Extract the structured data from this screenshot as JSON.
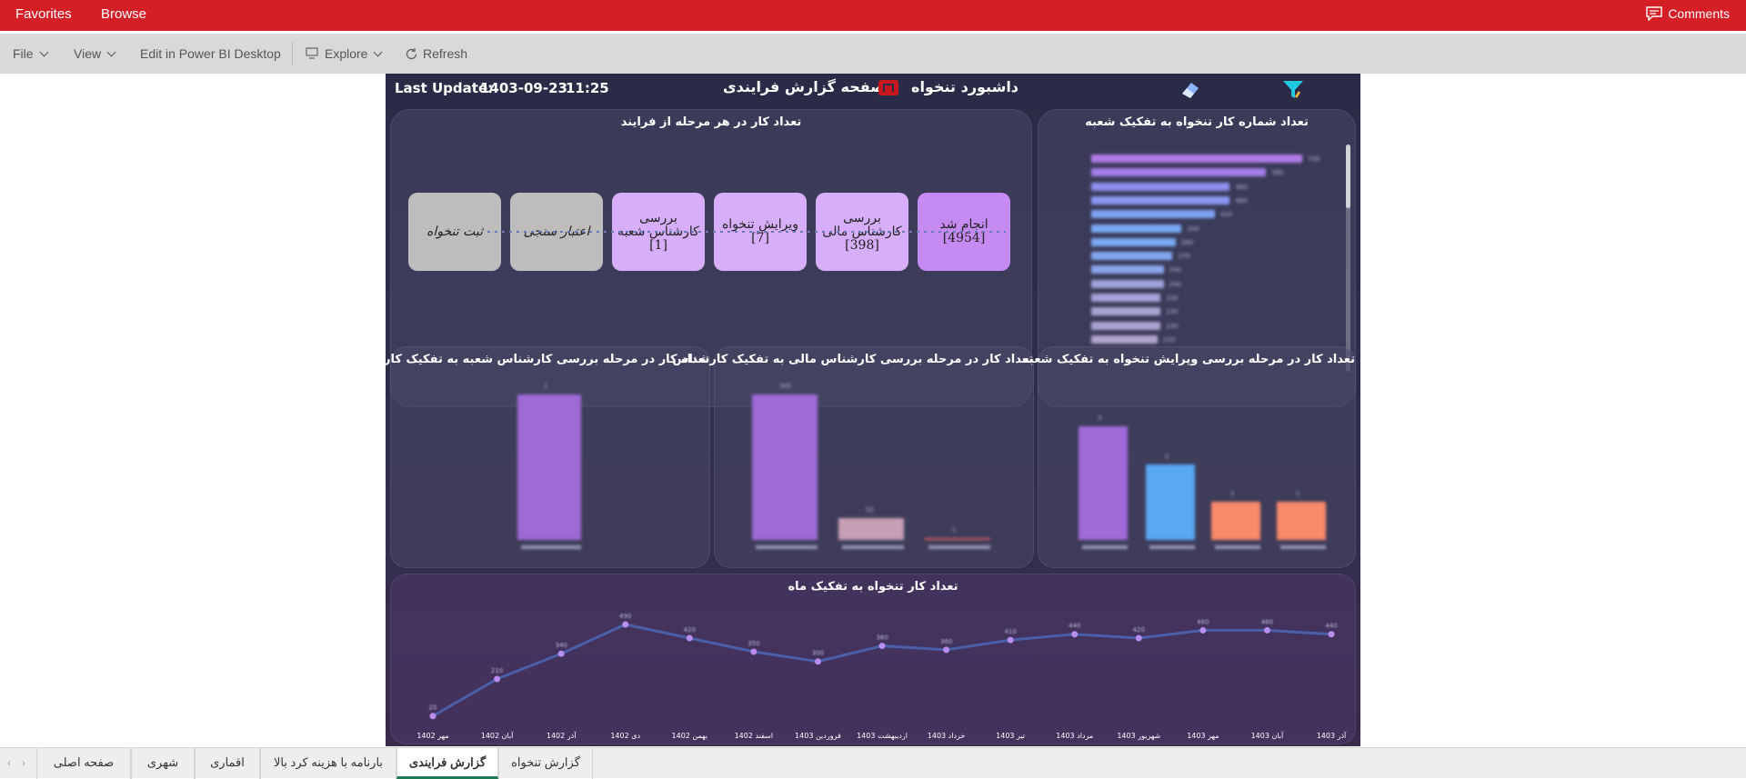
{
  "topbar": {
    "favorites": "Favorites",
    "browse": "Browse",
    "comments": "Comments"
  },
  "toolbar": {
    "file": "File",
    "view": "View",
    "edit": "Edit in Power BI Desktop",
    "explore": "Explore",
    "refresh": "Refresh"
  },
  "header": {
    "last_update_label": "Last Update:",
    "last_update_date": "1403-09-23",
    "last_update_time": "11:25",
    "title_right": "داشبورد  تنخواه",
    "title_left": "صفحه گزارش فرایندی"
  },
  "panels": {
    "process": {
      "title": "تعداد کار در هر مرحله از فرایند",
      "steps": [
        {
          "label": "انجام شد",
          "count": "[4954]",
          "state": "done"
        },
        {
          "label": "بررسی کارشناس مالی",
          "count": "[398]",
          "state": "active"
        },
        {
          "label": "ویرایش تنخواه",
          "count": "[7]",
          "state": "active"
        },
        {
          "label": "بررسی کارشناس شعبه",
          "count": "[1]",
          "state": "active"
        },
        {
          "label": "اعتبار سنجی",
          "count": "",
          "state": "idle"
        },
        {
          "label": "ثبت تنخواه",
          "count": "",
          "state": "idle"
        }
      ]
    },
    "branch": {
      "title": "تعداد شماره کار تنخواه به تفکیک شعبه"
    },
    "expert_branch": {
      "title": "تعداد کار در مرحله بررسی کارشناس شعبه به تفکیک کارشناس"
    },
    "expert_finance": {
      "title": "تعداد کار در مرحله بررسی کارشناس مالی به تفکیک کارشناس"
    },
    "edit_branch": {
      "title": "تعداد کار در مرحله بررسی وپرایش تنخواه به تفکیک شعبه"
    },
    "monthly": {
      "title": "تعداد کار تنخواه به تفکیک ماه"
    }
  },
  "chart_data": [
    {
      "type": "line",
      "title": "تعداد کار تنخواه به تفکیک ماه",
      "categories": [
        "مهر 1402",
        "آبان 1402",
        "آذر 1402",
        "دی 1402",
        "بهمن 1402",
        "اسفند 1402",
        "فروردین 1403",
        "اردیبهشت 1403",
        "خرداد 1403",
        "تیر 1403",
        "مرداد 1403",
        "شهریور 1403",
        "مهر 1403",
        "آبان 1403",
        "آذر 1403"
      ],
      "values": [
        20,
        210,
        340,
        490,
        420,
        350,
        300,
        380,
        360,
        410,
        440,
        420,
        460,
        460,
        440
      ],
      "ylim": [
        0,
        560
      ]
    },
    {
      "type": "bar",
      "title": "تعداد کار در مرحله بررسی کارشناس مالی به تفکیک کارشناس",
      "values": [
        345,
        52,
        1
      ]
    },
    {
      "type": "bar",
      "title": "تعداد کار در مرحله بررسی وپرایش تنخواه به تفکیک شعبه",
      "values": [
        3,
        2,
        1,
        1
      ]
    },
    {
      "type": "bar",
      "title": "تعداد کار در مرحله بررسی کارشناس شعبه به تفکیک کارشناس",
      "values": [
        1
      ]
    },
    {
      "type": "bar",
      "title": "تعداد شماره کار تنخواه به تفکیک شعبه",
      "values": [
        700,
        580,
        460,
        460,
        410,
        300,
        280,
        270,
        240,
        240,
        230,
        230,
        230,
        220
      ],
      "colors": [
        "#b07be6",
        "#a47de8",
        "#8f8ff0",
        "#8a97f2",
        "#7ea2f4",
        "#7aa8f4",
        "#7aa8f4",
        "#82a8f0",
        "#8aa5ec",
        "#a0a4dc",
        "#a4a4d8",
        "#a8a4d4",
        "#aca4d0",
        "#b0a4cc"
      ]
    }
  ],
  "tabs": [
    "صفحه اصلی",
    "شهری",
    "اقماری",
    "بارنامه با هزینه کرد بالا",
    "گزارش فرایندی",
    "گزارش تنخواه"
  ],
  "active_tab": "گزارش فرایندی"
}
